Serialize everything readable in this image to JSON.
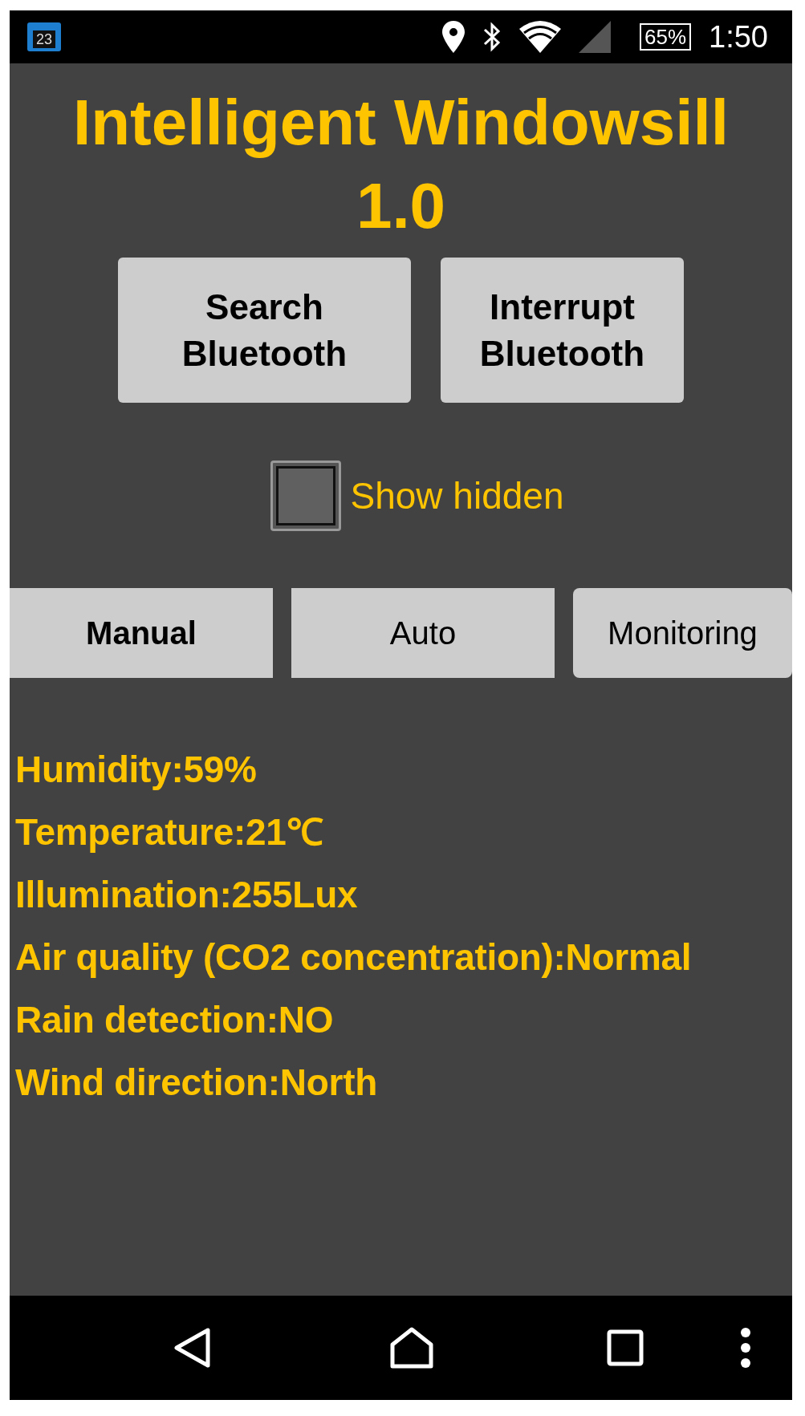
{
  "status_bar": {
    "calendar_day": "23",
    "battery": "65%",
    "time": "1:50"
  },
  "title": "Intelligent Windowsill 1.0",
  "buttons": [
    "Search Bluetooth",
    "Interrupt Bluetooth"
  ],
  "show_hidden": {
    "label": "Show hidden",
    "checked": false
  },
  "tabs": [
    {
      "label": "Manual",
      "selected": true
    },
    {
      "label": "Auto",
      "selected": false
    },
    {
      "label": "Monitoring",
      "selected": false
    }
  ],
  "readings": [
    "Humidity:59%",
    "Temperature:21℃",
    "Illumination:255Lux",
    "Air quality (CO2 concentration):Normal",
    "Rain detection:NO",
    "Wind direction:North"
  ]
}
